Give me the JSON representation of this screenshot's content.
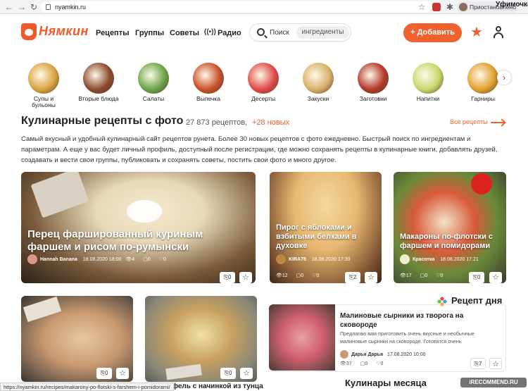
{
  "browser": {
    "url": "nyamkin.ru",
    "profile": "Приостановлено",
    "watermark_top": "Уфимочка",
    "status_url": "https://nyamkin.ru/recipes/makarony-po-flotski-s-farshem-i-pomidorami/",
    "watermark_bottom": "iRECOMMEND.RU"
  },
  "header": {
    "logo": "Нямкин",
    "nav": [
      "Рецепты",
      "Группы",
      "Советы",
      "Радио"
    ],
    "search_label": "Поиск",
    "search_mode": "ингредиенты",
    "add_button": "+ Добавить"
  },
  "categories": [
    {
      "label": "Супы и бульоны",
      "color": "#d9a441"
    },
    {
      "label": "Вторые блюда",
      "color": "#8a4b2d"
    },
    {
      "label": "Салаты",
      "color": "#6ba64a"
    },
    {
      "label": "Выпечка",
      "color": "#c8502a"
    },
    {
      "label": "Десерты",
      "color": "#e04a4a"
    },
    {
      "label": "Закуски",
      "color": "#d8b06a"
    },
    {
      "label": "Заготовки",
      "color": "#b33a2a"
    },
    {
      "label": "Напитки",
      "color": "#c9d86b"
    },
    {
      "label": "Гарниры",
      "color": "#e0a030"
    }
  ],
  "section": {
    "title": "Кулинарные рецепты с фото",
    "count": "27 873 рецептов,",
    "new_count": "+28 новых",
    "all_link": "Все рецепты",
    "intro": "Самый вкусный и удобный кулинарный сайт рецептов рунета. Более 30 новых рецептов с фото ежедневно. Быстрый поиск по ингредиентам и параметрам. А еще у вас будет личный профиль, доступный после регистрации, где можно сохранять рецепты в кулинарные книги, добавлять друзей, создавать и вести свои группы, публиковать и сохранять советы, постить свои фото и много другое."
  },
  "cards": [
    {
      "title": "Перец фаршированный куриным фаршем и рисом по-румынски",
      "author": "Hannah Banana",
      "date": "18.08.2020 18:00",
      "views": "4",
      "comments": "0",
      "likes": "0",
      "saves": "0"
    },
    {
      "title": "Пирог с яблоками и взбитыми белками в духовке",
      "author": "KIRA75",
      "date": "18.08.2020 17:30",
      "views": "12",
      "comments": "0",
      "likes": "0",
      "saves": "2"
    },
    {
      "title": "Макароны по-флотски с фаршем и помидорами",
      "author": "Красотка",
      "date": "18.08.2020 17:21",
      "views": "17",
      "comments": "0",
      "likes": "0",
      "saves": "0"
    },
    {
      "saves": "0"
    },
    {
      "saves": "0"
    }
  ],
  "recipe_of_day": {
    "heading": "Рецепт дня",
    "title": "Малиновые сырники из творога на сковороде",
    "desc": "Предлагаю вам приготовить очень вкусные и необычные малиновые сырники на сковороде. Готовятся очень",
    "author": "Дарья Дарья",
    "date": "17.08.2020 10:00",
    "views": "37",
    "comments": "0",
    "likes": "0",
    "saves": "7"
  },
  "tuna_title": "рофель с начинкой из тунца",
  "cooks_month": "Кулинары месяца"
}
